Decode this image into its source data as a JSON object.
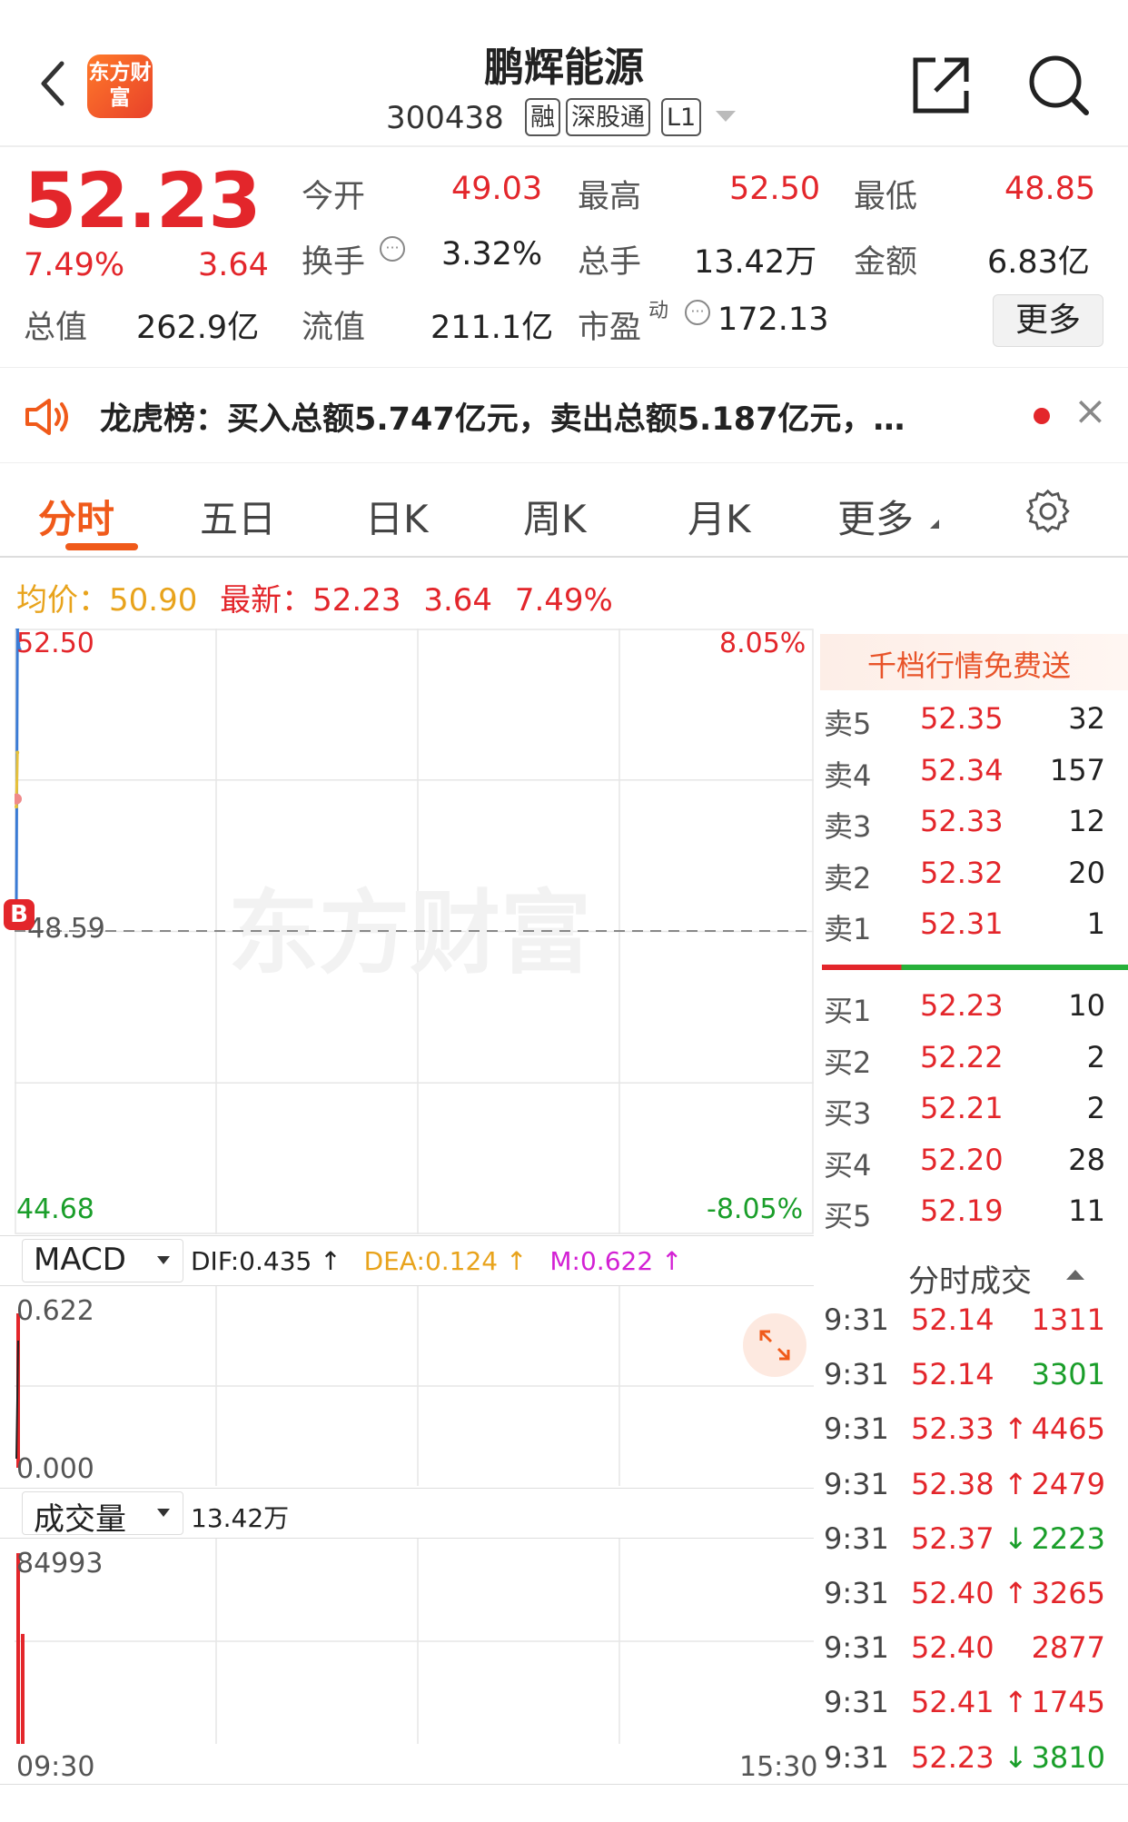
{
  "header": {
    "back_label": "<",
    "logo_text": "东方财富",
    "title": "鹏辉能源",
    "code": "300438",
    "tags": [
      "融",
      "深股通",
      "L1"
    ],
    "share_icon": "share-icon",
    "search_icon": "search-icon"
  },
  "quote": {
    "price": "52.23",
    "change_pct": "7.49%",
    "change": "3.64",
    "open_label": "今开",
    "open": "49.03",
    "high_label": "最高",
    "high": "52.50",
    "low_label": "最低",
    "low": "48.85",
    "turnover_label": "换手",
    "turnover": "3.32%",
    "volume_label": "总手",
    "volume": "13.42万",
    "amount_label": "金额",
    "amount": "6.83亿",
    "mktcap_label": "总值",
    "mktcap": "262.9亿",
    "float_label": "流值",
    "float": "211.1亿",
    "pe_label": "市盈",
    "pe_sup": "动",
    "pe": "172.13",
    "more_button": "更多"
  },
  "notice": {
    "text": "龙虎榜：买入总额5.747亿元，卖出总额5.187亿元，…",
    "close": "×"
  },
  "tabs": [
    "分时",
    "五日",
    "日K",
    "周K",
    "月K",
    "更多"
  ],
  "active_tab": 0,
  "price_line": {
    "avg_label": "均价：",
    "avg": "50.90",
    "latest_label": "最新：",
    "latest": "52.23",
    "latest_change": "3.64",
    "latest_pct": "7.49%"
  },
  "chart_data": [
    {
      "type": "line",
      "title": "",
      "y_max_label": "52.50",
      "y_mid_label": "48.59",
      "y_min_label": "44.68",
      "pct_max_label": "8.05%",
      "pct_min_label": "-8.05%",
      "ylim": [
        44.68,
        52.5
      ],
      "prev_close": 48.59,
      "x_start_label": "09:30",
      "x_end_label": "15:30",
      "series": [
        {
          "name": "price",
          "color": "#3a7bd5",
          "x": [
            "09:30",
            "09:30",
            "09:31",
            "09:31"
          ],
          "values": [
            48.85,
            52.5,
            52.3,
            52.23
          ]
        },
        {
          "name": "avg",
          "color": "#e8c13a",
          "x": [
            "09:30",
            "09:31"
          ],
          "values": [
            50.2,
            50.9
          ]
        }
      ],
      "buy_marker": "B",
      "watermark": "东方财富"
    },
    {
      "type": "bar",
      "title": "MACD",
      "indicators": {
        "dif": "DIF:0.435 ↑",
        "dea": "DEA:0.124 ↑",
        "m": "M:0.622 ↑"
      },
      "y_max_label": "0.622",
      "y_min_label": "0.000",
      "ylim": [
        0,
        0.622
      ],
      "values": [
        0.622
      ]
    },
    {
      "type": "bar",
      "title": "成交量",
      "total": "13.42万",
      "y_max_label": "84993",
      "ylim": [
        0,
        84993
      ],
      "values": [
        84993,
        49000
      ]
    }
  ],
  "order_book": {
    "banner": "千档行情免费送",
    "sells": [
      {
        "label": "卖5",
        "price": "52.35",
        "qty": "32"
      },
      {
        "label": "卖4",
        "price": "52.34",
        "qty": "157"
      },
      {
        "label": "卖3",
        "price": "52.33",
        "qty": "12"
      },
      {
        "label": "卖2",
        "price": "52.32",
        "qty": "20"
      },
      {
        "label": "卖1",
        "price": "52.31",
        "qty": "1"
      }
    ],
    "buys": [
      {
        "label": "买1",
        "price": "52.23",
        "qty": "10"
      },
      {
        "label": "买2",
        "price": "52.22",
        "qty": "2"
      },
      {
        "label": "买3",
        "price": "52.21",
        "qty": "2"
      },
      {
        "label": "买4",
        "price": "52.20",
        "qty": "28"
      },
      {
        "label": "买5",
        "price": "52.19",
        "qty": "11"
      }
    ]
  },
  "ticks": {
    "title": "分时成交",
    "rows": [
      {
        "time": "9:31",
        "price": "52.14",
        "arrow": "",
        "qty": "1311",
        "qty_color": "#e3262b"
      },
      {
        "time": "9:31",
        "price": "52.14",
        "arrow": "",
        "qty": "3301",
        "qty_color": "#1a9e2a"
      },
      {
        "time": "9:31",
        "price": "52.33",
        "arrow": "↑",
        "qty": "4465",
        "qty_color": "#e3262b"
      },
      {
        "time": "9:31",
        "price": "52.38",
        "arrow": "↑",
        "qty": "2479",
        "qty_color": "#e3262b"
      },
      {
        "time": "9:31",
        "price": "52.37",
        "arrow": "↓",
        "qty": "2223",
        "qty_color": "#1a9e2a"
      },
      {
        "time": "9:31",
        "price": "52.40",
        "arrow": "↑",
        "qty": "3265",
        "qty_color": "#e3262b"
      },
      {
        "time": "9:31",
        "price": "52.40",
        "arrow": "",
        "qty": "2877",
        "qty_color": "#e3262b"
      },
      {
        "time": "9:31",
        "price": "52.41",
        "arrow": "↑",
        "qty": "1745",
        "qty_color": "#e3262b"
      },
      {
        "time": "9:31",
        "price": "52.23",
        "arrow": "↓",
        "qty": "3810",
        "qty_color": "#1a9e2a"
      }
    ]
  },
  "colors": {
    "up": "#e3262b",
    "down": "#1a9e2a",
    "accent": "#f05a1a",
    "avg": "#e8a31c"
  }
}
